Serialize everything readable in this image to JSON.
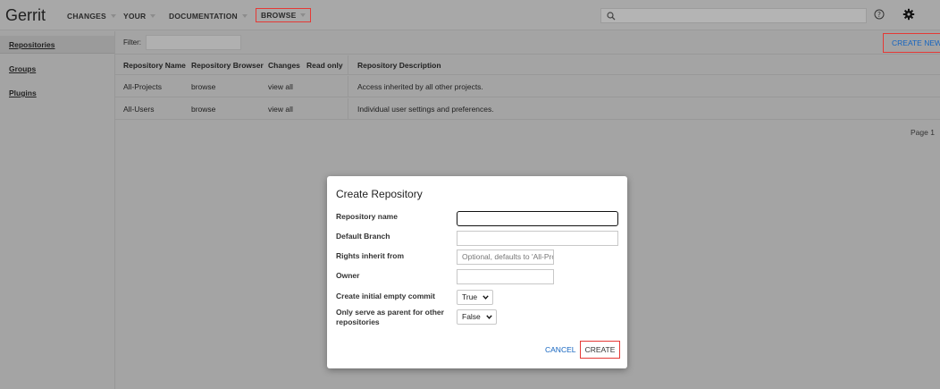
{
  "app": {
    "logo": "Gerrit"
  },
  "nav": {
    "changes": "CHANGES",
    "your": "YOUR",
    "documentation": "DOCUMENTATION",
    "browse": "BROWSE"
  },
  "sidebar": {
    "items": [
      {
        "label": "Repositories",
        "selected": true
      },
      {
        "label": "Groups"
      },
      {
        "label": "Plugins"
      }
    ]
  },
  "toolbar": {
    "filter_label": "Filter:",
    "filter_value": "",
    "create_new": "CREATE NEW"
  },
  "table": {
    "headers": {
      "name": "Repository Name",
      "browser": "Repository Browser",
      "changes": "Changes",
      "readonly": "Read only",
      "description": "Repository Description"
    },
    "rows": [
      {
        "name": "All-Projects",
        "browser": "browse",
        "changes": "view all",
        "readonly": "",
        "description": "Access inherited by all other projects."
      },
      {
        "name": "All-Users",
        "browser": "browse",
        "changes": "view all",
        "readonly": "",
        "description": "Individual user settings and preferences."
      }
    ]
  },
  "pagination": {
    "label": "Page 1"
  },
  "dialog": {
    "title": "Create Repository",
    "fields": {
      "repo_name": {
        "label": "Repository name",
        "value": ""
      },
      "default_branch": {
        "label": "Default Branch",
        "value": ""
      },
      "rights_inherit": {
        "label": "Rights inherit from",
        "placeholder": "Optional, defaults to 'All-Projects'"
      },
      "owner": {
        "label": "Owner",
        "value": ""
      },
      "initial_commit": {
        "label": "Create initial empty commit",
        "value": "True"
      },
      "parent_only": {
        "label": "Only serve as parent for other repositories",
        "value": "False"
      }
    },
    "cancel": "CANCEL",
    "create": "CREATE"
  },
  "colors": {
    "accent_link": "#1565c0",
    "highlight_box": "#e53935",
    "overlay_bg": "#a4a4a4"
  },
  "icons": [
    "search-icon",
    "help-icon",
    "gear-icon",
    "chevron-down-icon"
  ]
}
